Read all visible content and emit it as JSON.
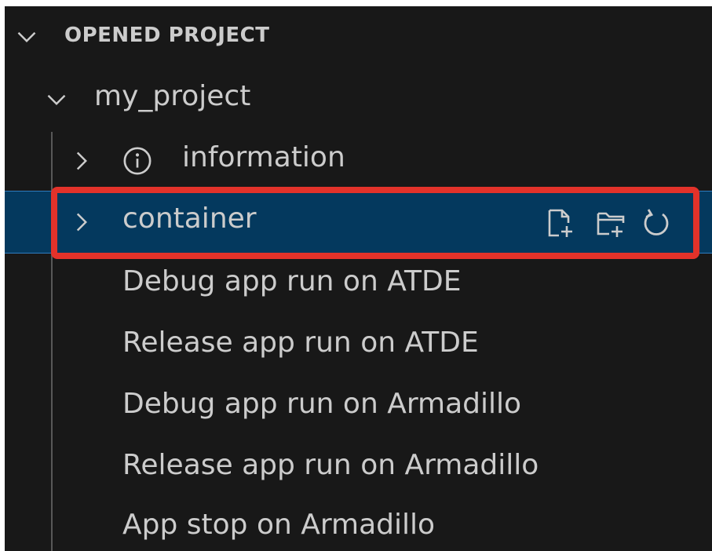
{
  "explorer": {
    "section_title": "OPENED PROJECT",
    "project": {
      "name": "my_project",
      "items": [
        {
          "label": "information",
          "icon": "info-icon",
          "collapsible": true
        },
        {
          "label": "container",
          "icon": "none",
          "collapsible": true,
          "selected": true,
          "actions": [
            "new-file-icon",
            "new-folder-icon",
            "refresh-icon"
          ]
        },
        {
          "label": "Debug app run on ATDE"
        },
        {
          "label": "Release app run on ATDE"
        },
        {
          "label": "Debug app run on Armadillo"
        },
        {
          "label": "Release app run on Armadillo"
        },
        {
          "label": "App stop on Armadillo"
        }
      ]
    }
  },
  "colors": {
    "background": "#181818",
    "selection": "#04395e",
    "highlight_border": "#e3322a",
    "text": "#cccccc"
  }
}
